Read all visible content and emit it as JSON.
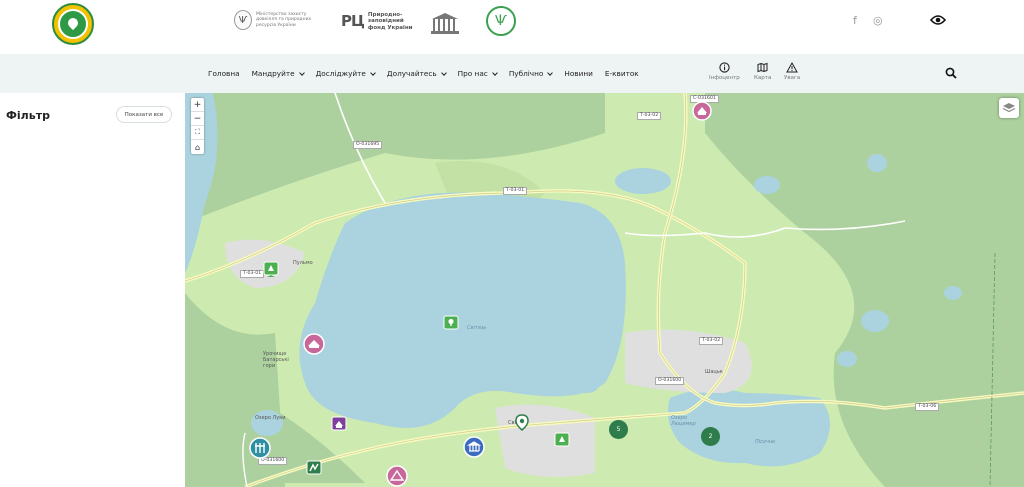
{
  "header": {
    "partners": [
      {
        "name": "ministry",
        "text": "Міністерство захисту довкілля та природних ресурсів України",
        "icon": "trident-icon"
      },
      {
        "name": "nfu",
        "mark": "РЦ",
        "text": "Природно-заповідний фонд України"
      },
      {
        "name": "unesco",
        "icon": "temple-icon"
      },
      {
        "name": "eco",
        "icon": "leaf-trident-icon"
      }
    ],
    "social": {
      "facebook": "f",
      "instagram": "◎"
    },
    "accessibility_icon": "eye-icon"
  },
  "nav": {
    "items": [
      {
        "label": "Головна",
        "dropdown": false
      },
      {
        "label": "Мандруйте",
        "dropdown": true
      },
      {
        "label": "Досліджуйте",
        "dropdown": true
      },
      {
        "label": "Долучайтесь",
        "dropdown": true
      },
      {
        "label": "Про нас",
        "dropdown": true
      },
      {
        "label": "Публічно",
        "dropdown": true
      },
      {
        "label": "Новини",
        "dropdown": false
      },
      {
        "label": "Е-квиток",
        "dropdown": false
      }
    ],
    "tools": [
      {
        "label": "Інфоцентр",
        "icon": "info-icon"
      },
      {
        "label": "Карта",
        "icon": "map-icon"
      },
      {
        "label": "Увага",
        "icon": "warning-icon"
      }
    ],
    "search_icon": "search-icon"
  },
  "sidebar": {
    "title": "Фільтр",
    "show_all": "Показати все"
  },
  "map": {
    "controls": {
      "zoom_in": "+",
      "zoom_out": "−",
      "fullscreen": "⛶",
      "home": "⌂"
    },
    "roads": [
      "С-031601",
      "Т-03-02",
      "О-031695",
      "Т-03-01",
      "Т-03-01",
      "Т-03-02",
      "О-031600",
      "О-031600",
      "Т-03-06"
    ],
    "places": [
      "Пульмо",
      "Світязь",
      "Шацьк",
      "Урочище Батарські гори",
      "Озеро Луки"
    ],
    "lakes": [
      "Світязь",
      "Пісочне",
      "Озеро Люцимер"
    ],
    "clusters": [
      "5",
      "2"
    ],
    "colors": {
      "water": "#aad3df",
      "forest": "#add19e",
      "meadow": "#cdebb0",
      "urban": "#e0dfdf",
      "road": "#f7fabf",
      "green_marker": "#4caf50",
      "pink_marker": "#c8679a",
      "purple_marker": "#7e3f9d",
      "teal_marker": "#2e8fa2",
      "blue_marker": "#3b6cbf"
    }
  }
}
